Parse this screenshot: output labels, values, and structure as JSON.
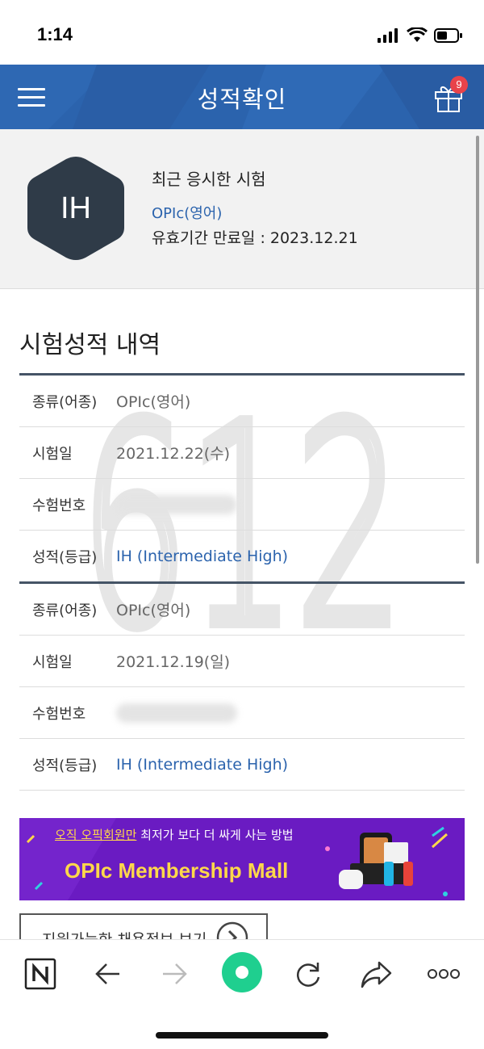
{
  "status_bar": {
    "time": "1:14"
  },
  "header": {
    "title": "성적확인",
    "gift_badge_count": "9"
  },
  "recent": {
    "grade": "IH",
    "label": "최근 응시한 시험",
    "test_name": "OPIc(영어)",
    "expiry": "유효기간 만료일 : 2023.12.21"
  },
  "history": {
    "title": "시험성적 내역",
    "watermark_text": "612",
    "records": [
      {
        "type_label": "종류(어종)",
        "type_value": "OPIc(영어)",
        "date_label": "시험일",
        "date_value": "2021.12.22(수)",
        "id_label": "수험번호",
        "grade_label": "성적(등급)",
        "grade_value": "IH (Intermediate High)"
      },
      {
        "type_label": "종류(어종)",
        "type_value": "OPIc(영어)",
        "date_label": "시험일",
        "date_value": "2021.12.19(일)",
        "id_label": "수험번호",
        "grade_label": "성적(등급)",
        "grade_value": "IH (Intermediate High)"
      }
    ]
  },
  "banner": {
    "top_highlight": "오직 오픽회원만",
    "top_rest": "최저가 보다 더 싸게 사는 방법",
    "main": "OPIc Membership Mall"
  },
  "job_button": {
    "label": "지원가능한 채용정보 보기"
  },
  "colors": {
    "header_blue": "#2b63ad",
    "hex_dark": "#2f3b48",
    "banner_purple": "#6a1bc2",
    "accent_green": "#1fcf8f"
  }
}
